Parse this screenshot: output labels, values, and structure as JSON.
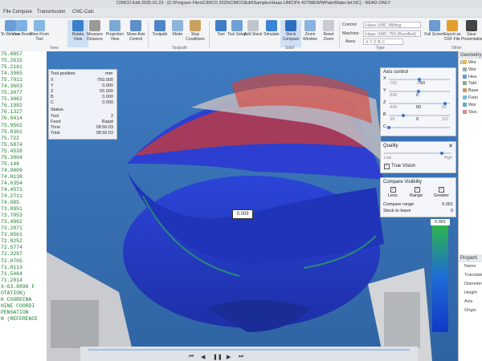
{
  "title": "CIMCO Edit 2025.01.23 - [C:\\Program Files\\CIMCO 2025\\CIMCOEdit\\Samples\\Haas UMC\\Pk 42798EWWPaintWaterJet.NC] - READ-ONLY",
  "menu": [
    "File Compare",
    "Transmission",
    "CNC-Calc"
  ],
  "ribbon": {
    "buttons": [
      "To Window",
      "View Reset",
      "View From Tool",
      "Rotate View",
      "Measure Distance",
      "Projection View",
      "Show Axis Control",
      "Toolpath",
      "Mode",
      "Stop Conditions",
      "Tool",
      "Tool Setup",
      "Add Stock",
      "Simulate",
      "Stock Compare",
      "Zoom Window",
      "Reset Zoom",
      "Full Screen",
      "Export as DXF File",
      "Save Presentation"
    ],
    "groups": [
      "View",
      "Toolpath",
      "Solid",
      "Type",
      "Other"
    ],
    "control_label": "Control",
    "control_value": "Haas UMC Milling",
    "machine_label": "Machine",
    "machine_value": "Haas UMC-750 (Bundled)",
    "axes_label": "Axes",
    "axes_value": "X Y Z B C"
  },
  "code_lines": [
    "75.8857",
    "75.2615",
    "75.2161",
    "74.3965",
    "75.7011",
    "74.3603",
    "75.3077",
    "75.3062",
    "76.1992",
    "76.1327",
    "76.0414",
    "75.9502",
    "75.8361",
    "75.722",
    "75.5874",
    "75.4528",
    "75.3004",
    "75.148",
    "74.9809",
    "74.8138",
    "74.6354",
    "74.4571",
    "74.2711",
    "74.085",
    "73.8951",
    "73.7053",
    "73.4962",
    "73.2871",
    "73.0561",
    "72.8252",
    "72.5774",
    "72.3297",
    "72.0705",
    "71.8113",
    "71.5464",
    "71.2814",
    "X-63.8896 F",
    "OTATION)",
    "K COORDINA",
    "HINE COORDI",
    "PENSATION",
    "N (REFERENCE"
  ],
  "tool_position": {
    "title": "Tool position",
    "unit": "mm",
    "rows": [
      {
        "k": "X",
        "v": "-750.000"
      },
      {
        "k": "Y",
        "v": "0.000"
      },
      {
        "k": "Z",
        "v": "65.000"
      },
      {
        "k": "B",
        "v": "0.000"
      },
      {
        "k": "C",
        "v": "0.000"
      }
    ],
    "status_title": "Status",
    "status": [
      {
        "k": "Tool",
        "v": "2"
      },
      {
        "k": "Feed",
        "v": "Rapid"
      },
      {
        "k": "Time",
        "v": "08:56:03"
      },
      {
        "k": "Total",
        "v": "08:56:03"
      }
    ]
  },
  "axis_control": {
    "title": "Axis control",
    "rows": [
      {
        "k": "X",
        "min": "-762",
        "val": "-750",
        "level": 0.51
      },
      {
        "k": "Y",
        "min": "-508",
        "val": "0",
        "level": 0.5
      },
      {
        "k": "Z",
        "min": "-440",
        "val": "60",
        "max": "60",
        "level": 0.95
      },
      {
        "k": "B",
        "min": "-35",
        "val": "0",
        "max": "110",
        "level": 0.24
      },
      {
        "k": "C",
        "min": "",
        "val": "",
        "level": 0.0
      }
    ]
  },
  "quality": {
    "title": "Quality",
    "low": "Low",
    "high": "High",
    "true_vision": "True Vision",
    "level": 0.85
  },
  "compare": {
    "title": "Compare Visibility",
    "less": "Less",
    "range": "Range",
    "greater": "Greater",
    "range_label": "Compare range",
    "range_value": "0.001",
    "stock_label": "Stock to leave",
    "stock_value": "0"
  },
  "legend_top": "0.001",
  "measure_label": "0.003",
  "tree": {
    "header": "Geometry P",
    "items": [
      "Wor",
      "Wor",
      "Hea",
      "Tabl",
      "Base",
      "Fixtu",
      "Wor",
      "Stoc"
    ]
  },
  "properties": {
    "header": "Properti",
    "items": [
      "Name",
      "Translatio",
      "Diameter",
      "Height",
      "Axis",
      "Origin"
    ]
  },
  "colors": {
    "accent": "#3a73c2",
    "code": "#1a7a2a",
    "viewport": "#3a72b0"
  }
}
